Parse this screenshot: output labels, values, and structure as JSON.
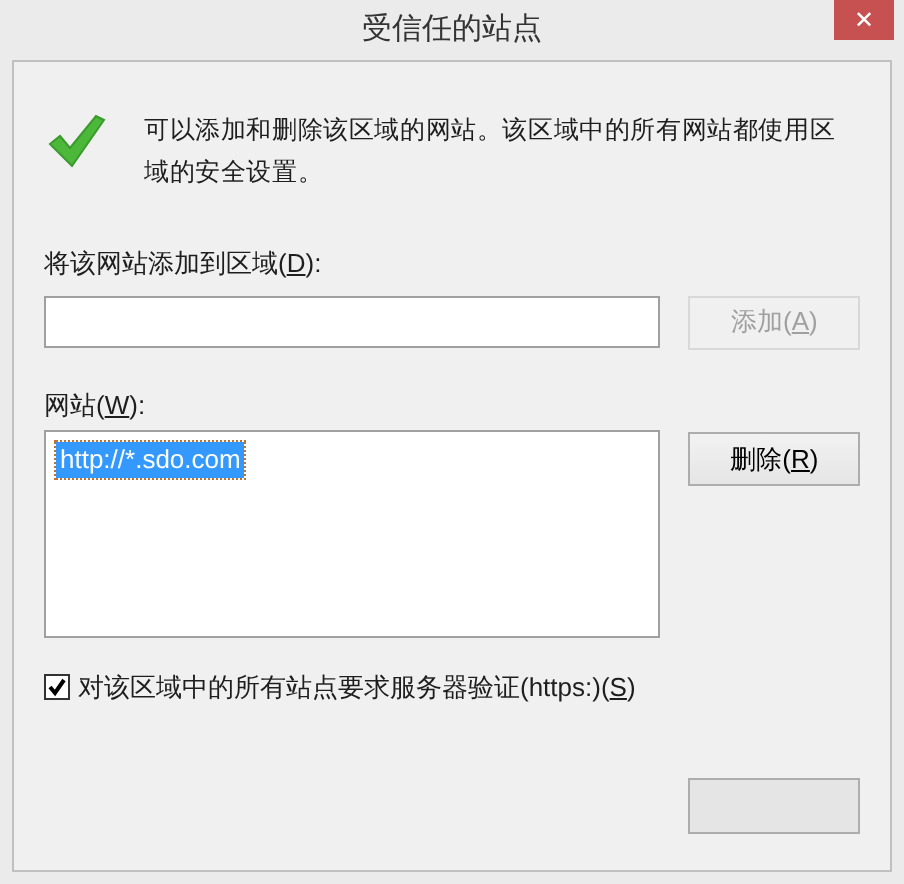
{
  "window": {
    "title": "受信任的站点",
    "close": "✕"
  },
  "info": {
    "text": "可以添加和删除该区域的网站。该区域中的所有网站都使用区域的安全设置。"
  },
  "add_field": {
    "label": {
      "before": "将该网站添加到区域(",
      "key": "D",
      "after": "):"
    }
  },
  "add_button": {
    "label": {
      "before": "添加(",
      "key": "A",
      "after": ")"
    },
    "disabled": true
  },
  "sites": {
    "label": {
      "before": "网站(",
      "key": "W",
      "after": "):"
    },
    "items": [
      {
        "text": "http://*.sdo.com",
        "selected": true
      }
    ]
  },
  "remove_button": {
    "label": {
      "before": "删除(",
      "key": "R",
      "after": ")"
    },
    "disabled": false
  },
  "https_option": {
    "label": {
      "before": "对该区域中的所有站点要求服务器验证(https:)(",
      "key": "S",
      "after": ")"
    },
    "checked": true
  }
}
